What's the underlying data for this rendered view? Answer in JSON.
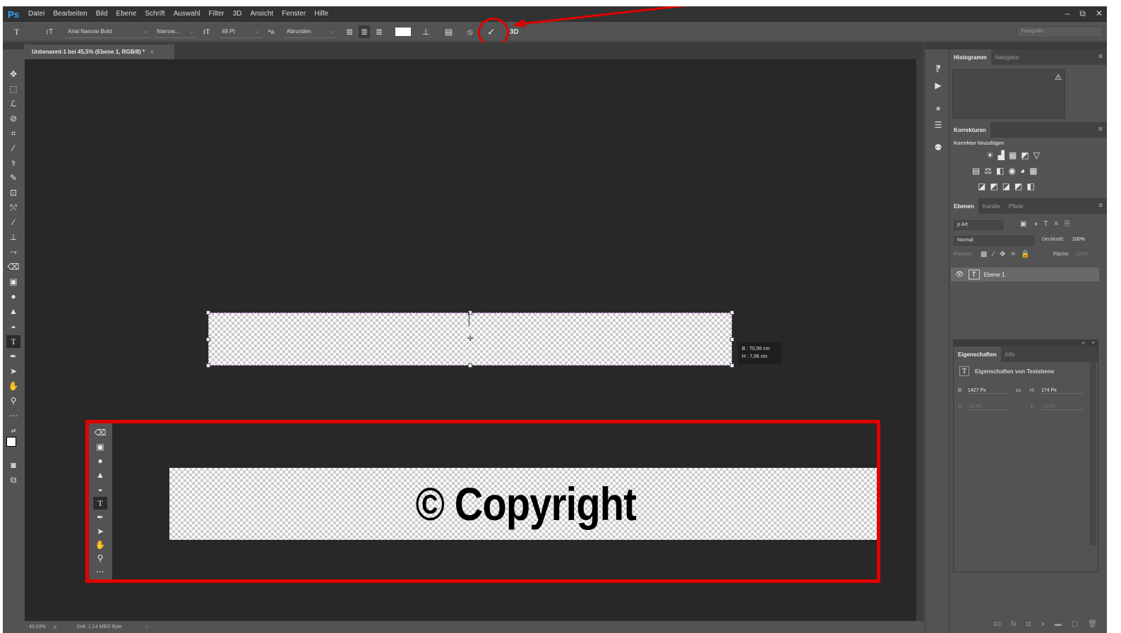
{
  "app": {
    "logo": "Ps",
    "menu": [
      "Datei",
      "Bearbeiten",
      "Bild",
      "Ebene",
      "Schrift",
      "Auswahl",
      "Filter",
      "3D",
      "Ansicht",
      "Fenster",
      "Hilfe"
    ],
    "window_controls": [
      "–",
      "⧉",
      "✕"
    ]
  },
  "options": {
    "tool_icon": "T",
    "orient_icon": "↕T",
    "font_family": "Arial Narrow Bold",
    "font_style": "Narrow...",
    "size_icon": "tT",
    "font_size": "48 Pt",
    "aa_icon": "ªa",
    "antialias": "Abrunden",
    "threed": "3D",
    "workspace": "Fotografie"
  },
  "document": {
    "tab_title": "Unbenannt-1 bei 45,5% (Ebene 1, RGB/8) *",
    "close": "×",
    "tooltip_w": "B :  70,56 cm",
    "tooltip_h": "H :   7,06 cm",
    "zoom": "45,53%",
    "doc_info": "Dok: 1,14 MB/0 Byte",
    "status_arrow": "›"
  },
  "inset": {
    "text": "© Copyright"
  },
  "panels": {
    "histogram_tab": "Histogramm",
    "navigator_tab": "Navigator",
    "adjust_tab": "Korrekturen",
    "adjust_sub": "Korrektur hinzufügen",
    "layers_tab": "Ebenen",
    "channels_tab": "Kanäle",
    "paths_tab": "Pfade",
    "filter_placeholder": "ρ Art",
    "blend_mode": "Normal",
    "opacity_label": "Deckkraft:",
    "opacity_value": "100%",
    "lock_label": "Fixieren:",
    "fill_label": "Fläche:",
    "fill_value": "100%",
    "layer_name": "Ebene 1",
    "props_tab": "Eigenschaften",
    "info_tab": "Info",
    "props_title": "Eigenschaften von Textebene",
    "w_label": "B:",
    "w_value": "1427 Px",
    "h_label": "H:",
    "h_value": "174 Px",
    "x_label": "X:",
    "x_value": "-10 Px",
    "y_label": "Y:",
    "y_value": "-13 Px",
    "link_icon": "ɢɔ"
  },
  "colors": {
    "highlight": "#e00000",
    "ui_bg": "#535353",
    "canvas_bg": "#282828",
    "selection": "#b06cc0"
  }
}
